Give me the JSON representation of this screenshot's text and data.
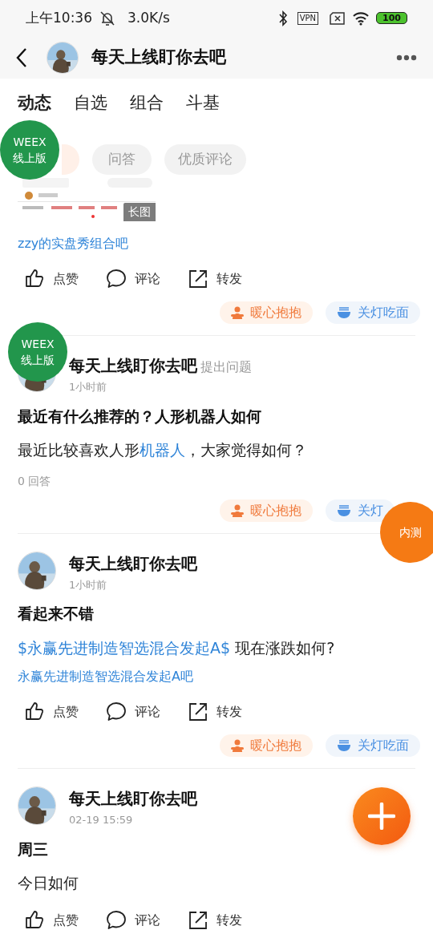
{
  "status_bar": {
    "time": "上午10:36",
    "speed": "3.0K/s",
    "vpn": "VPN",
    "battery": "100"
  },
  "header": {
    "title": "每天上线盯你去吧"
  },
  "tabs": [
    {
      "label": "动态",
      "selected": true
    },
    {
      "label": "自选",
      "selected": false
    },
    {
      "label": "组合",
      "selected": false
    },
    {
      "label": "斗基",
      "selected": false
    }
  ],
  "filters": [
    {
      "selected": true
    },
    {
      "label": "问答",
      "selected": false
    },
    {
      "label": "优质评论",
      "selected": false
    }
  ],
  "posts": [
    {
      "image_badge": "长图",
      "bar": "zzy的实盘秀组合吧",
      "actions": [
        "点赞",
        "评论",
        "转发"
      ],
      "reactions": [
        {
          "kind": "hug",
          "label": "暖心抱抱"
        },
        {
          "kind": "noodle",
          "label": "关灯吃面"
        }
      ]
    },
    {
      "kind": "question",
      "author": "每天上线盯你去吧",
      "action": "提出问题",
      "time": "1小时前",
      "title": "最近有什么推荐的？人形机器人如何",
      "body": [
        {
          "text": "最近比较喜欢人形"
        },
        {
          "text": "机器人",
          "link": true
        },
        {
          "text": "，大家觉得如何？"
        }
      ],
      "answers": "0 回答",
      "reactions": [
        {
          "kind": "hug",
          "label": "暖心抱抱"
        },
        {
          "kind": "noodle",
          "label": "关灯"
        }
      ]
    },
    {
      "kind": "post",
      "author": "每天上线盯你去吧",
      "time": "1小时前",
      "title": "看起来不错",
      "body": [
        {
          "text": "$永赢先进制造智选混合发起A$",
          "link": true
        },
        {
          "text": " 现在涨跌如何?"
        }
      ],
      "bar": "永赢先进制造智选混合发起A吧",
      "actions": [
        "点赞",
        "评论",
        "转发"
      ],
      "reactions": [
        {
          "kind": "hug",
          "label": "暖心抱抱"
        },
        {
          "kind": "noodle",
          "label": "关灯吃面"
        }
      ]
    },
    {
      "kind": "post",
      "author": "每天上线盯你去吧",
      "time": "02-19 15:59",
      "title": "周三",
      "body": [
        {
          "text": "今日如何"
        }
      ],
      "actions": [
        "点赞",
        "评论",
        "转发"
      ]
    }
  ],
  "overlays": [
    {
      "kind": "weex",
      "lines": [
        "WEEX",
        "线上版"
      ]
    },
    {
      "kind": "weex",
      "lines": [
        "WEEX",
        "线上版"
      ]
    },
    {
      "kind": "beta",
      "label": "内测"
    },
    {
      "kind": "add"
    }
  ]
}
